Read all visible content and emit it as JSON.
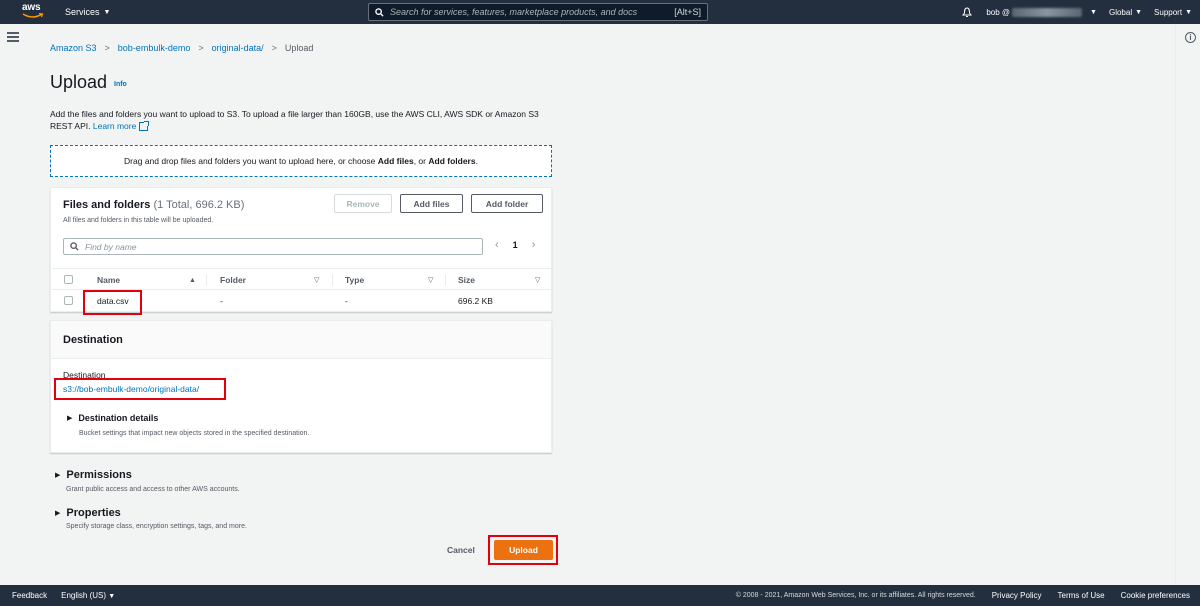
{
  "nav": {
    "logo": "aws",
    "services": "Services",
    "search_placeholder": "Search for services, features, marketplace products, and docs",
    "search_shortcut": "[Alt+S]",
    "account": "bob @",
    "region": "Global",
    "support": "Support"
  },
  "breadcrumb": [
    "Amazon S3",
    "bob-embulk-demo",
    "original-data/",
    "Upload"
  ],
  "page": {
    "title": "Upload",
    "info": "Info",
    "desc_prefix": "Add the files and folders you want to upload to S3. To upload a file larger than 160GB, use the AWS CLI, AWS SDK or Amazon S3 REST API.",
    "learn_more": "Learn more"
  },
  "dropzone": {
    "text1": "Drag and drop files and folders you want to upload here, or choose ",
    "add_files": "Add files",
    "text2": ", or ",
    "add_folders": "Add folders",
    "text3": "."
  },
  "files": {
    "title": "Files and folders",
    "count": "(1 Total, 696.2 KB)",
    "subtitle": "All files and folders in this table will be uploaded.",
    "remove": "Remove",
    "add_files": "Add files",
    "add_folder": "Add folder",
    "find_placeholder": "Find by name",
    "page": "1",
    "columns": [
      "Name",
      "Folder",
      "Type",
      "Size"
    ],
    "rows": [
      {
        "name": "data.csv",
        "folder": "-",
        "type": "-",
        "size": "696.2 KB"
      }
    ]
  },
  "destination": {
    "title": "Destination",
    "label": "Destination",
    "uri": "s3://bob-embulk-demo/original-data/",
    "details_title": "Destination details",
    "details_sub": "Bucket settings that impact new objects stored in the specified destination."
  },
  "permissions": {
    "title": "Permissions",
    "sub": "Grant public access and access to other AWS accounts."
  },
  "properties": {
    "title": "Properties",
    "sub": "Specify storage class, encryption settings, tags, and more."
  },
  "actions": {
    "cancel": "Cancel",
    "upload": "Upload"
  },
  "footer": {
    "feedback": "Feedback",
    "language": "English (US)",
    "copyright": "© 2008 - 2021, Amazon Web Services, Inc. or its affiliates. All rights reserved.",
    "privacy": "Privacy Policy",
    "terms": "Terms of Use",
    "cookies": "Cookie preferences"
  },
  "colors": {
    "nav_bg": "#232f3e",
    "link": "#0073bb",
    "primary": "#ec7211",
    "highlight": "#e2000c"
  }
}
